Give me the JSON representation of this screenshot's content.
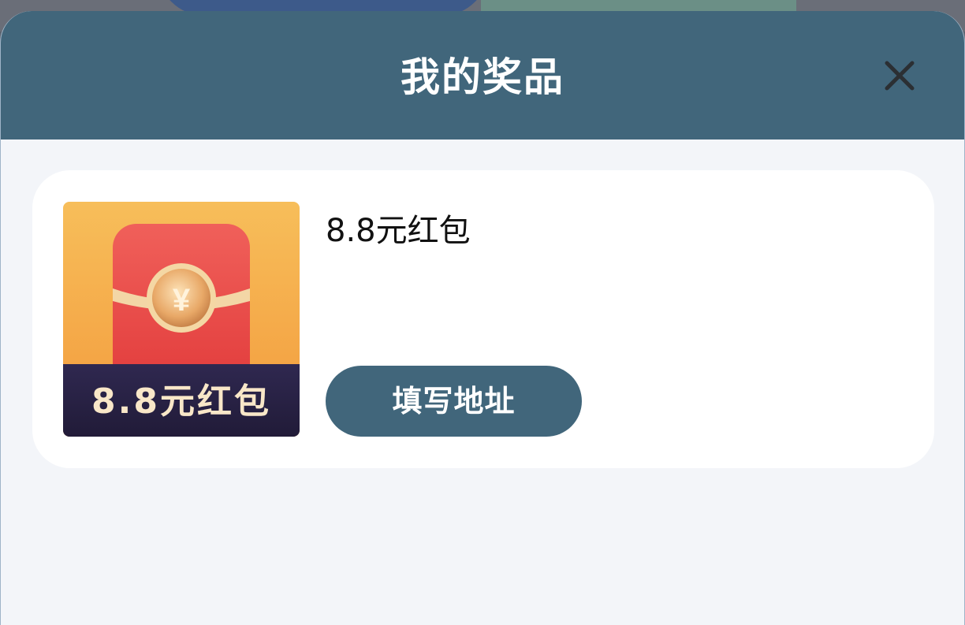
{
  "modal": {
    "title": "我的奖品",
    "close_icon": "close-icon"
  },
  "prizes": [
    {
      "name": "8.8元红包",
      "image_caption": "8.8元红包",
      "image_symbol": "¥",
      "action_label": "填写地址"
    }
  ],
  "colors": {
    "header_bg": "#41667b",
    "button_bg": "#41667b",
    "sheet_bg": "#f3f5f9",
    "card_bg": "#ffffff",
    "envelope_red": "#e84a4a",
    "image_bg_gold": "#f5b450",
    "image_band_dark": "#2a2346"
  }
}
